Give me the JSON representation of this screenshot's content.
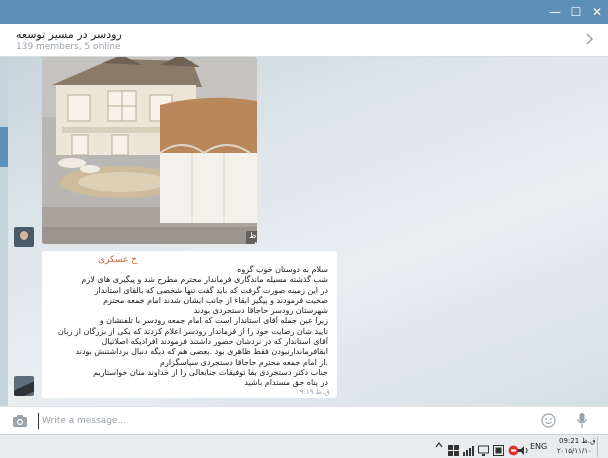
{
  "window": {
    "minimize_glyph": "—",
    "maximize_glyph": "☐",
    "close_glyph": "✕"
  },
  "header": {
    "title": "رودسر در مسیر توسعه",
    "subtitle": "139 members, 5 online",
    "chevron_icon": "chevron-right-icon"
  },
  "messages": {
    "photo": {
      "caption_time": "ق.ظ ۰۸:۲۶",
      "description_icon": "photo-thumbnail"
    },
    "text_message": {
      "sender": "ح عسکری",
      "lines": [
        "سلام به دوستان خوب گروه",
        "شب گذشته مسیله ماندگاری فرماندار محترم مطرح شد و پیگیری های لازم",
        "در این زمینه صورت گرفت که باید گفت  تنها شخصی که بالقای استاندار",
        "صحبت فرمودند و پیگیر ابقاء از جانب ایشان شدند امام جمعه محترم",
        "شهرستان رودسر حاجاقا دستجردی بودند",
        "زیرا عین جمله آقای استاندار است که امام جمعه رودسر با تلفنشان و",
        "تایید شان رضایت خود را از فرماندار رودسر اعلام کردند که یکی از بزرگان از زبان",
        "آقای استاندار که در نزدشان حضور داشتند فرمودند افرادیکه اصلاتیال",
        "ابقافرماندارنبودن فقط ظاهری بود .بعضی هم که دیگه دنبال برداشتنش بودند",
        ".از امام جمعه محترم حاجاقا دستجردی سپاسگزارم",
        "جناب دکتر دستجردی بقا توفیقات جنابعالی را از خداوند منان خواستاریم",
        "در پناه حق مستدام باشید"
      ],
      "time": "ق.ظ ۰۹:۱۹"
    }
  },
  "composer": {
    "placeholder": "Write a message...",
    "value": "",
    "camera_icon": "camera-icon",
    "emoji_icon": "emoji-icon",
    "mic_icon": "microphone-icon"
  },
  "taskbar": {
    "language": "ENG",
    "clock_time": "ق.ظ 09:21",
    "clock_date": "۲۰۱۵/۱۱/۱۰"
  },
  "colors": {
    "titlebar": "#5e8fb6",
    "sender_name": "#d25f2b",
    "background": "#dfe6ea"
  }
}
